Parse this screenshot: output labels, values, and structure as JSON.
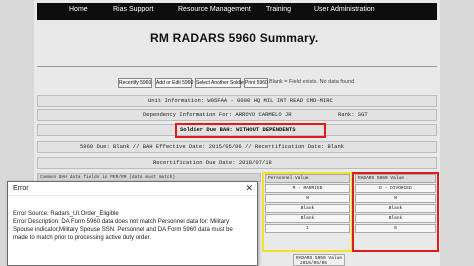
{
  "nav": {
    "items": [
      "Home",
      "Rias Support",
      "Resource Management",
      "Training",
      "User Administration"
    ]
  },
  "title": "RM RADARS 5960 Summary.",
  "toolbar": {
    "buttons": [
      "Recertify 5960",
      "Add or Edit 5960",
      "Select Another Soldier",
      "Print 5960"
    ],
    "note": "Blank = Field exists. No data found"
  },
  "info": {
    "unit": "Unit Information: W95FAA - 0000 HQ MIL INT READ CMD-MIRC",
    "dependency": "Dependency Information For: ARROYO CARMELO JR",
    "rank": "Rank: SGT",
    "due_bah": "Soldier Due BAH: WITHOUT DEPENDENTS",
    "due_5960": "5960 Due: Blank // BAH Effective Date: 2015/05/06 // Recertification Date: Blank",
    "recert_due": "Recertification Due Date: 2018/07/18"
  },
  "grid_caption": "Common BAH data fields in PER/RM (data must match)",
  "personnel_table": {
    "header": "Personnel Value",
    "rows": [
      "M - MARRIED",
      "N",
      "Blank",
      "Blank",
      "1"
    ]
  },
  "radars_table": {
    "header": "RADARS 5960 Value",
    "rows": [
      "D - DIVORCED",
      "N",
      "Blank",
      "Blank",
      "0"
    ]
  },
  "radars_value": {
    "label": "RADARS 5960 Value",
    "date": "2015/05/06"
  },
  "error": {
    "title": "Error",
    "close": "✕",
    "lines": [
      "Error Source: Radars_UI.Order_Eligible",
      "Error Description: DA Form 5960 data does not match Personnel data for: Military",
      "Spouse indicator,Military Spouse SSN. Personnel and DA Form 5960 data must be",
      "made to match prior to processing active duty order."
    ]
  }
}
